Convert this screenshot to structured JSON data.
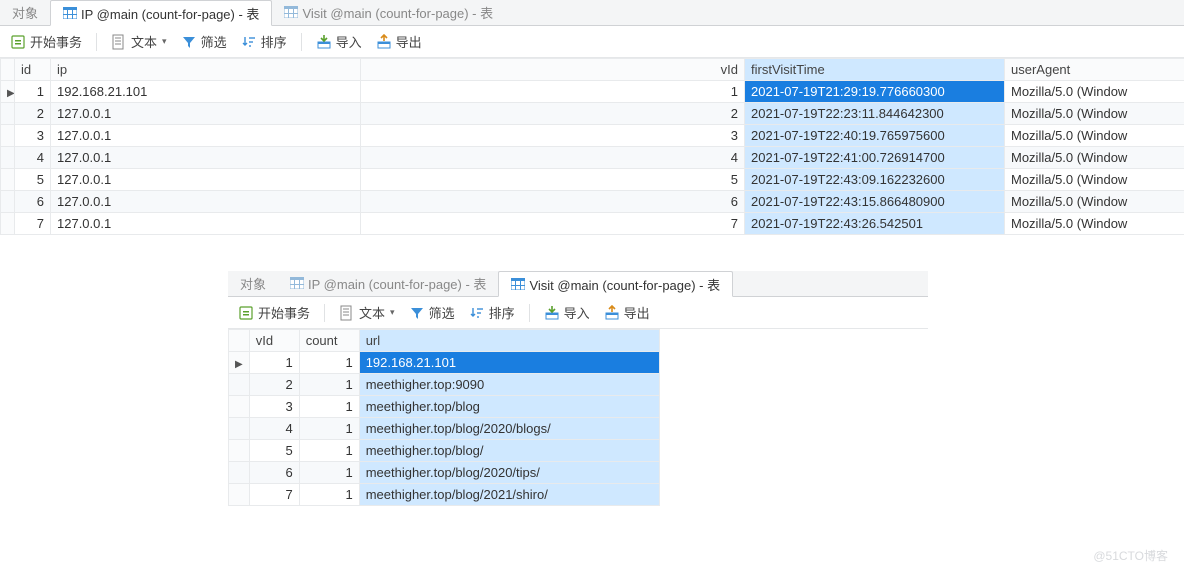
{
  "tabs_top": {
    "obj": "对象",
    "ip": "IP @main (count-for-page) - 表",
    "visit": "Visit @main (count-for-page) - 表"
  },
  "toolbar": {
    "begin_tx": "开始事务",
    "text": "文本",
    "filter": "筛选",
    "sort": "排序",
    "import": "导入",
    "export": "导出"
  },
  "grid1": {
    "cols": {
      "id": "id",
      "ip": "ip",
      "vId": "vId",
      "firstVisitTime": "firstVisitTime",
      "userAgent": "userAgent"
    },
    "rows": [
      {
        "id": "1",
        "ip": "192.168.21.101",
        "vId": "1",
        "firstVisitTime": "2021-07-19T21:29:19.776660300",
        "userAgent": "Mozilla/5.0 (Window"
      },
      {
        "id": "2",
        "ip": "127.0.0.1",
        "vId": "2",
        "firstVisitTime": "2021-07-19T22:23:11.844642300",
        "userAgent": "Mozilla/5.0 (Window"
      },
      {
        "id": "3",
        "ip": "127.0.0.1",
        "vId": "3",
        "firstVisitTime": "2021-07-19T22:40:19.765975600",
        "userAgent": "Mozilla/5.0 (Window"
      },
      {
        "id": "4",
        "ip": "127.0.0.1",
        "vId": "4",
        "firstVisitTime": "2021-07-19T22:41:00.726914700",
        "userAgent": "Mozilla/5.0 (Window"
      },
      {
        "id": "5",
        "ip": "127.0.0.1",
        "vId": "5",
        "firstVisitTime": "2021-07-19T22:43:09.162232600",
        "userAgent": "Mozilla/5.0 (Window"
      },
      {
        "id": "6",
        "ip": "127.0.0.1",
        "vId": "6",
        "firstVisitTime": "2021-07-19T22:43:15.866480900",
        "userAgent": "Mozilla/5.0 (Window"
      },
      {
        "id": "7",
        "ip": "127.0.0.1",
        "vId": "7",
        "firstVisitTime": "2021-07-19T22:43:26.542501",
        "userAgent": "Mozilla/5.0 (Window"
      }
    ]
  },
  "grid2": {
    "cols": {
      "vId": "vId",
      "count": "count",
      "url": "url"
    },
    "rows": [
      {
        "vId": "1",
        "count": "1",
        "url": "192.168.21.101"
      },
      {
        "vId": "2",
        "count": "1",
        "url": "meethigher.top:9090"
      },
      {
        "vId": "3",
        "count": "1",
        "url": "meethigher.top/blog"
      },
      {
        "vId": "4",
        "count": "1",
        "url": "meethigher.top/blog/2020/blogs/"
      },
      {
        "vId": "5",
        "count": "1",
        "url": "meethigher.top/blog/"
      },
      {
        "vId": "6",
        "count": "1",
        "url": "meethigher.top/blog/2020/tips/"
      },
      {
        "vId": "7",
        "count": "1",
        "url": "meethigher.top/blog/2021/shiro/"
      }
    ]
  },
  "watermark": "@51CTO博客"
}
